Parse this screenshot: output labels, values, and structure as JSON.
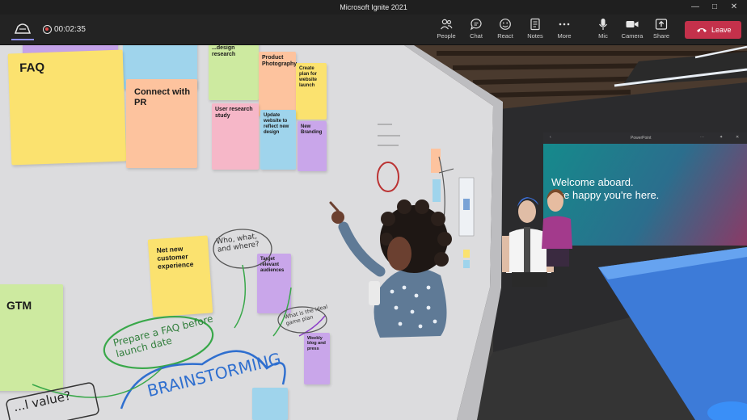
{
  "window": {
    "title": "Microsoft Ignite 2021"
  },
  "meeting": {
    "elapsed": "00:02:35"
  },
  "toolbar": {
    "people": "People",
    "chat": "Chat",
    "react": "React",
    "notes": "Notes",
    "more": "More",
    "mic": "Mic",
    "camera": "Camera",
    "share": "Share",
    "leave": "Leave"
  },
  "whiteboard": {
    "notes": {
      "faq": "FAQ",
      "connect_pr": "Connect with PR",
      "design_research": "...design research",
      "product_photography": "Product Photography",
      "create_plan": "Create plan for website launch",
      "user_research": "User research study",
      "update_website": "Update website to reflect new design",
      "new_branding": "New Branding",
      "net_new": "Net new customer experience",
      "gtm": "GTM",
      "target_audience": "Target relevant audiences",
      "weekly": "Weekly blog and press"
    },
    "handwriting": {
      "who_what": "Who, what, and where?",
      "prepare_faq": "Prepare a FAQ before launch date",
      "brainstorming": "BRAINSTORMING",
      "what_ideal": "What is the ideal game plan",
      "value": "...l value?"
    }
  },
  "presentation": {
    "app_title": "PowerPoint",
    "headline_1": "Welcome aboard.",
    "headline_2": "...re happy you're here."
  },
  "colors": {
    "leave": "#c4314b",
    "yellow_note": "#fbe26f",
    "orange_note": "#fdc39e",
    "purple_note": "#c9a6ea",
    "blue_note": "#9fd8ef",
    "green_note": "#cdeaa0",
    "pink_note": "#f6b7c8"
  }
}
